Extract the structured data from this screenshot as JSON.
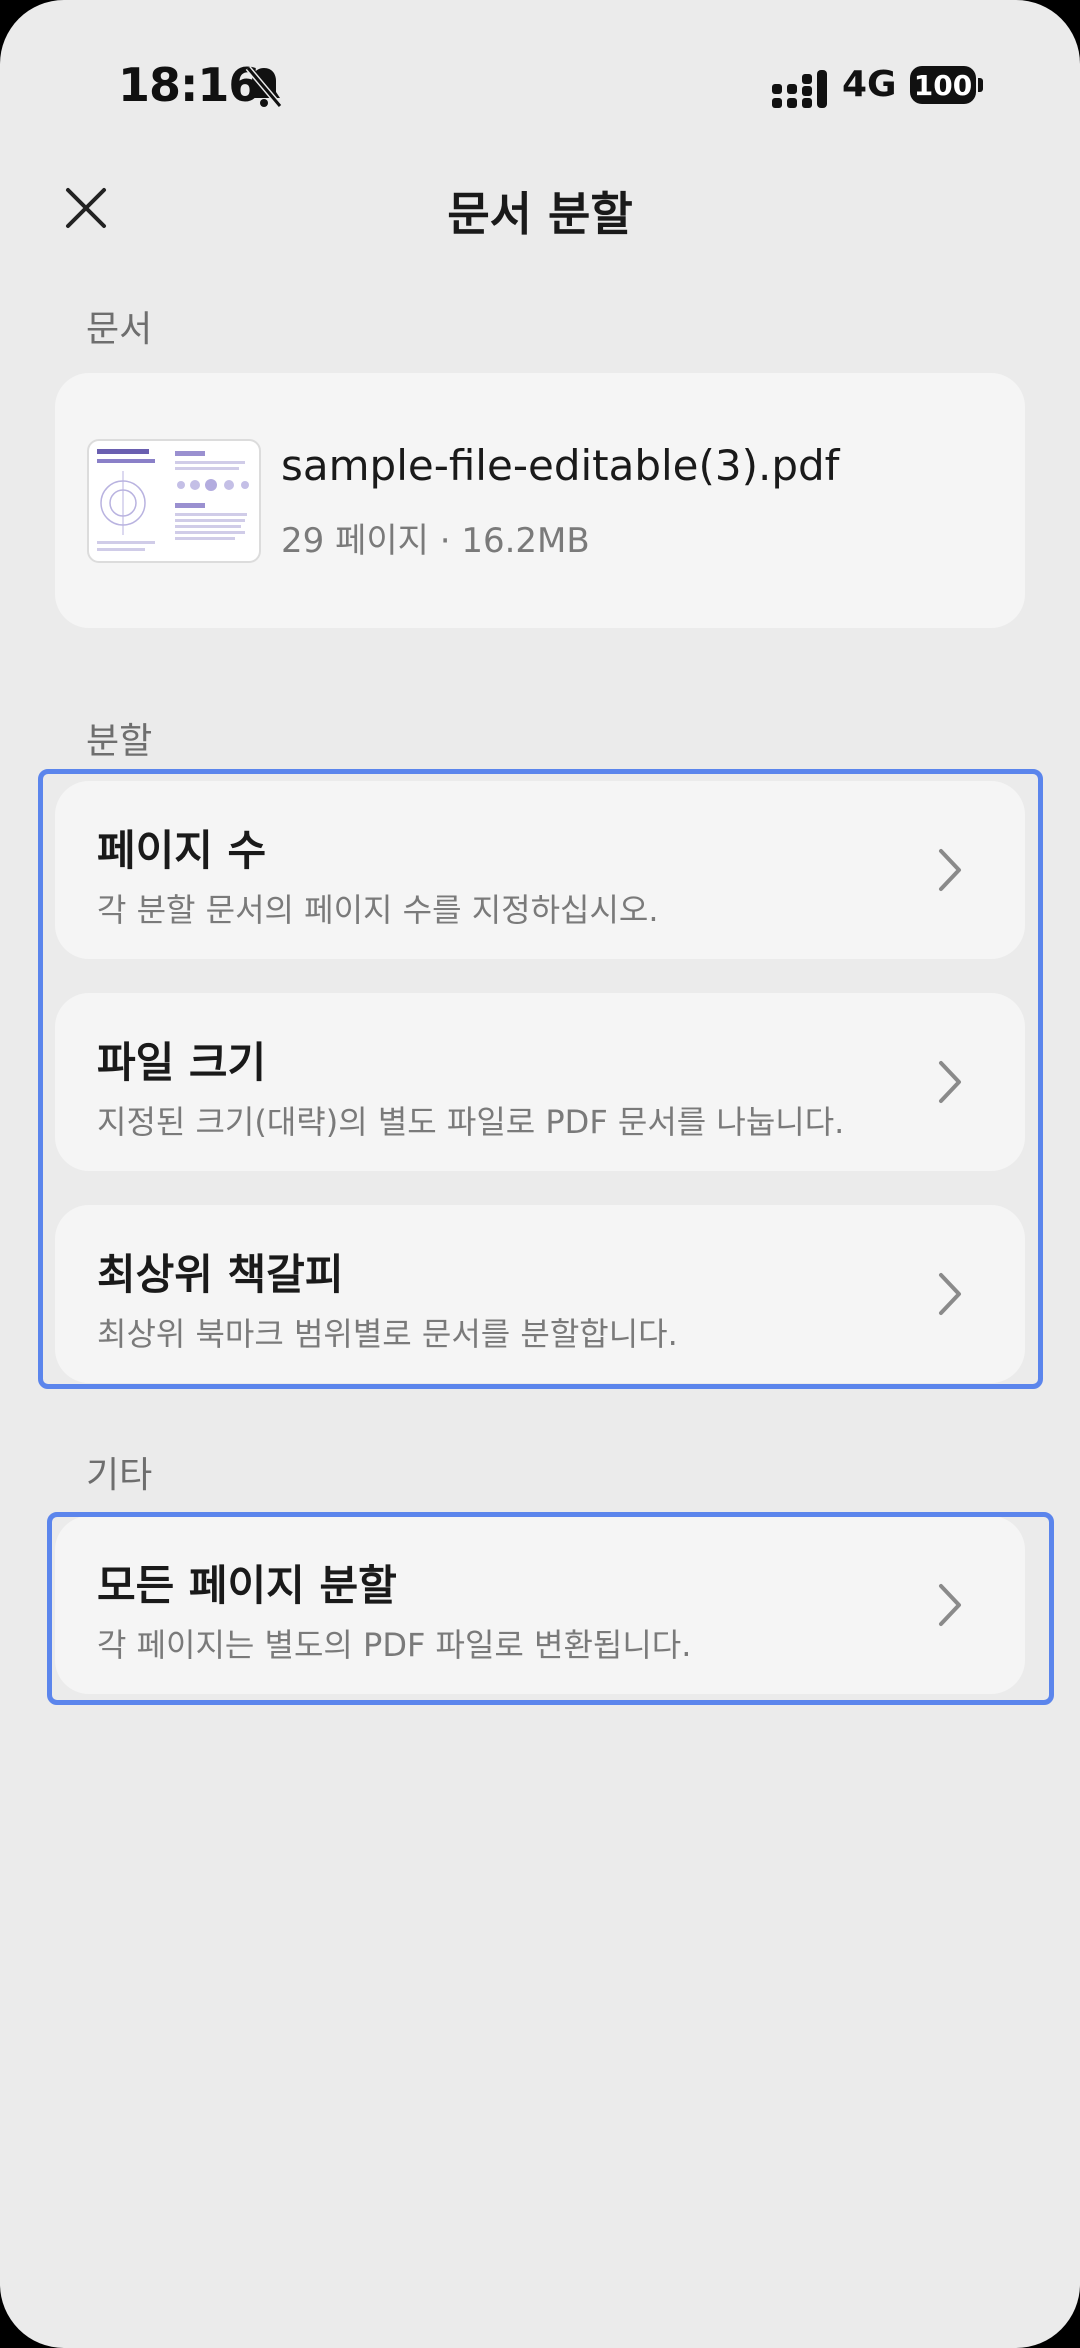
{
  "status_bar": {
    "time": "18:16",
    "network": "4G",
    "battery": "100",
    "icons": [
      "bell-muted-icon",
      "signal-icon"
    ]
  },
  "header": {
    "title": "문서 분할",
    "close_icon": "close-icon"
  },
  "document_section": {
    "label": "문서",
    "file": {
      "name": "sample-file-editable(3).pdf",
      "meta": "29 페이지 · 16.2MB"
    }
  },
  "split_section": {
    "label": "분할",
    "options": [
      {
        "title": "페이지 수",
        "description": "각 분할 문서의 페이지 수를 지정하십시오."
      },
      {
        "title": "파일 크기",
        "description": "지정된 크기(대략)의 별도 파일로 PDF 문서를 나눕니다."
      },
      {
        "title": "최상위 책갈피",
        "description": "최상위 북마크 범위별로 문서를 분할합니다."
      }
    ]
  },
  "other_section": {
    "label": "기타",
    "options": [
      {
        "title": "모든 페이지 분할",
        "description": "각 페이지는 별도의 PDF 파일로 변환됩니다."
      }
    ]
  },
  "colors": {
    "background": "#ebebeb",
    "card": "#f5f5f5",
    "highlight": "#5b85ec"
  }
}
